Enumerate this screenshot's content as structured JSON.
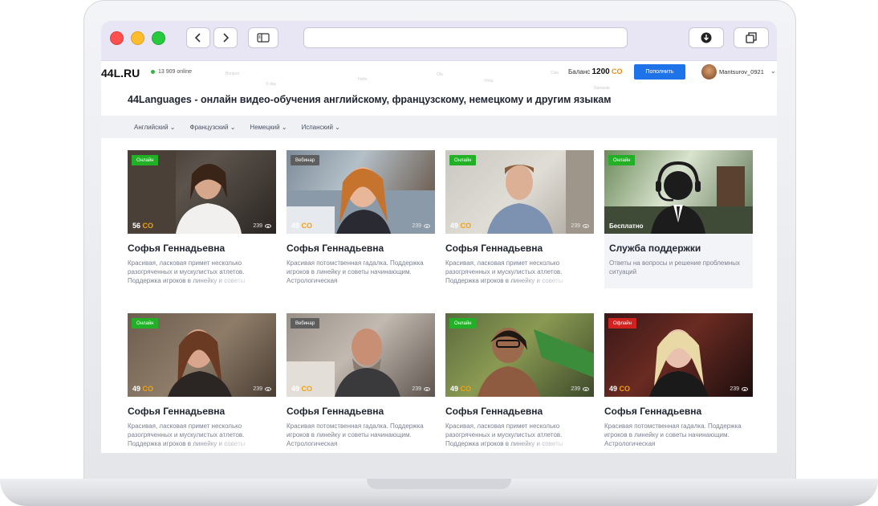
{
  "browser": {
    "back_label": "<",
    "forward_label": ">",
    "address": ""
  },
  "site": {
    "logo": "44L.RU",
    "online": "13 909 online",
    "balance_label": "Баланс",
    "balance_value": "1200",
    "currency": "CO",
    "topup_label": "Пополнить",
    "username": "Mantsurov_0921",
    "headline": "44Languages - онлайн видео-обучения английскому, французскому, немецкому и другим языкам",
    "decor_words": [
      "Bonjour",
      "O day",
      "Hello",
      "Ola",
      "Ciao",
      "Hola",
      "Namaste"
    ]
  },
  "languages": [
    "Английский",
    "Французский",
    "Немецкий",
    "Испанский"
  ],
  "cards": [
    {
      "badge": "Онлайн",
      "badge_color": "#22b126",
      "price": "56",
      "views": "239",
      "name": "Софья Геннадьевна",
      "desc": "Красивая, ласковая примет несколько разогряченных и мускулистых атлетов. Поддержка игроков в линейку и советы"
    },
    {
      "badge": "Вебинар",
      "badge_color": "#5e5e5e",
      "price": "49",
      "views": "239",
      "name": "Софья Геннадьевна",
      "desc": "Красивая потомственная гадалка. Поддержка игроков в линейку и советы начинающим. Астрологическая"
    },
    {
      "badge": "Онлайн",
      "badge_color": "#22b126",
      "price": "49",
      "views": "239",
      "name": "Софья Геннадьевна",
      "desc": "Красивая, ласковая примет несколько разогряченных и мускулистых атлетов. Поддержка игроков в линейку и советы"
    },
    {
      "badge": "Онлайн",
      "badge_color": "#22b126",
      "free": "Бесплатно",
      "name": "Служба поддержки",
      "desc": "Ответы на вопросы и решение проблемных ситуаций"
    },
    {
      "badge": "Онлайн",
      "badge_color": "#22b126",
      "price": "49",
      "views": "239",
      "name": "Софья Геннадьевна",
      "desc": "Красивая, ласковая примет несколько разогряченных и мускулистых атлетов. Поддержка игроков в линейку и советы"
    },
    {
      "badge": "Вебинар",
      "badge_color": "#5e5e5e",
      "price": "49",
      "views": "239",
      "name": "Софья Геннадьевна",
      "desc": "Красивая потомственная гадалка. Поддержка игроков в линейку и советы начинающим. Астрологическая"
    },
    {
      "badge": "Онлайн",
      "badge_color": "#22b126",
      "price": "49",
      "views": "239",
      "name": "Софья Геннадьевна",
      "desc": "Красивая, ласковая примет несколько разогряченных и мускулистых атлетов. Поддержка игроков в линейку и советы"
    },
    {
      "badge": "Офлайн",
      "badge_color": "#d0221f",
      "price": "49",
      "views": "239",
      "name": "Софья Геннадьевна",
      "desc": "Красивая потомственная гадалка. Поддержка игроков в линейку и советы начинающим. Астрологическая"
    }
  ]
}
